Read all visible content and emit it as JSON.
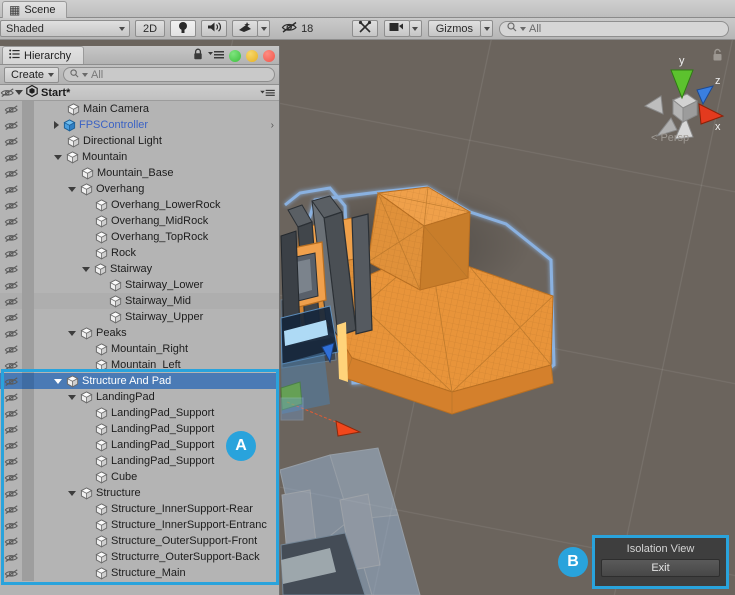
{
  "window": {
    "scene_tab_label": "Scene",
    "scene_tab_icon": "grid-hash-icon"
  },
  "toolbar": {
    "shading_mode": "Shaded",
    "mode_2d_label": "2D",
    "lighting_icon": "lightbulb-icon",
    "audio_icon": "speaker-icon",
    "effects_icon": "fx-icon",
    "hidden_count_icon": "eye-off-icon",
    "hidden_count": "18",
    "tools_icon": "tools-icon",
    "camera_icon": "camera-icon",
    "gizmos_label": "Gizmos",
    "search_placeholder": "All",
    "search_value": "",
    "search_icon": "search-icon"
  },
  "hierarchy": {
    "tab_label": "Hierarchy",
    "tab_icon": "list-icon",
    "lock_icon": "lock-icon",
    "menu_icon": "hamburger-menu-icon",
    "window_dots": [
      "green",
      "yellow",
      "red"
    ],
    "create_label": "Create",
    "search_placeholder": "All",
    "search_value": "",
    "scene_root": "Start*",
    "scene_root_icon": "unity-scene-icon",
    "items": [
      {
        "label": "Main Camera",
        "depth": 1,
        "arrow": "none",
        "selected": false,
        "alt": false,
        "blue": false
      },
      {
        "label": "FPSController",
        "depth": 1,
        "arrow": "closed",
        "selected": false,
        "alt": false,
        "blue": true,
        "prefab": true,
        "chevron": true
      },
      {
        "label": "Directional Light",
        "depth": 1,
        "arrow": "none",
        "selected": false,
        "alt": false,
        "blue": false
      },
      {
        "label": "Mountain",
        "depth": 1,
        "arrow": "open",
        "selected": false,
        "alt": false,
        "blue": false
      },
      {
        "label": "Mountain_Base",
        "depth": 2,
        "arrow": "none",
        "selected": false,
        "alt": false,
        "blue": false
      },
      {
        "label": "Overhang",
        "depth": 2,
        "arrow": "open",
        "selected": false,
        "alt": false,
        "blue": false
      },
      {
        "label": "Overhang_LowerRock",
        "depth": 3,
        "arrow": "none",
        "selected": false,
        "alt": false,
        "blue": false
      },
      {
        "label": "Overhang_MidRock",
        "depth": 3,
        "arrow": "none",
        "selected": false,
        "alt": false,
        "blue": false
      },
      {
        "label": "Overhang_TopRock",
        "depth": 3,
        "arrow": "none",
        "selected": false,
        "alt": false,
        "blue": false
      },
      {
        "label": "Rock",
        "depth": 3,
        "arrow": "none",
        "selected": false,
        "alt": false,
        "blue": false
      },
      {
        "label": "Stairway",
        "depth": 3,
        "arrow": "open",
        "selected": false,
        "alt": false,
        "blue": false
      },
      {
        "label": "Stairway_Lower",
        "depth": 4,
        "arrow": "none",
        "selected": false,
        "alt": false,
        "blue": false
      },
      {
        "label": "Stairway_Mid",
        "depth": 4,
        "arrow": "none",
        "selected": false,
        "alt": true,
        "blue": false
      },
      {
        "label": "Stairway_Upper",
        "depth": 4,
        "arrow": "none",
        "selected": false,
        "alt": false,
        "blue": false
      },
      {
        "label": "Peaks",
        "depth": 2,
        "arrow": "open",
        "selected": false,
        "alt": false,
        "blue": false
      },
      {
        "label": "Mountain_Right",
        "depth": 3,
        "arrow": "none",
        "selected": false,
        "alt": false,
        "blue": false
      },
      {
        "label": "Mountain_Left",
        "depth": 3,
        "arrow": "none",
        "selected": false,
        "alt": false,
        "blue": false
      },
      {
        "label": "Structure And Pad",
        "depth": 1,
        "arrow": "open",
        "selected": true,
        "alt": false,
        "blue": false
      },
      {
        "label": "LandingPad",
        "depth": 2,
        "arrow": "open",
        "selected": false,
        "alt": false,
        "blue": false
      },
      {
        "label": "LandingPad_Support",
        "depth": 3,
        "arrow": "none",
        "selected": false,
        "alt": false,
        "blue": false
      },
      {
        "label": "LandingPad_Support",
        "depth": 3,
        "arrow": "none",
        "selected": false,
        "alt": false,
        "blue": false
      },
      {
        "label": "LandingPad_Support",
        "depth": 3,
        "arrow": "none",
        "selected": false,
        "alt": false,
        "blue": false
      },
      {
        "label": "LandingPad_Support",
        "depth": 3,
        "arrow": "none",
        "selected": false,
        "alt": false,
        "blue": false
      },
      {
        "label": "Cube",
        "depth": 3,
        "arrow": "none",
        "selected": false,
        "alt": false,
        "blue": false
      },
      {
        "label": "Structure",
        "depth": 2,
        "arrow": "open",
        "selected": false,
        "alt": false,
        "blue": false
      },
      {
        "label": "Structure_InnerSupport-Rear",
        "depth": 3,
        "arrow": "none",
        "selected": false,
        "alt": false,
        "blue": false
      },
      {
        "label": "Structure_InnerSupport-Entranc",
        "depth": 3,
        "arrow": "none",
        "selected": false,
        "alt": false,
        "blue": false
      },
      {
        "label": "Structure_OuterSupport-Front",
        "depth": 3,
        "arrow": "none",
        "selected": false,
        "alt": false,
        "blue": false
      },
      {
        "label": "Structurre_OuterSupport-Back",
        "depth": 3,
        "arrow": "none",
        "selected": false,
        "alt": false,
        "blue": false
      },
      {
        "label": "Structure_Main",
        "depth": 3,
        "arrow": "none",
        "selected": false,
        "alt": false,
        "blue": false
      }
    ]
  },
  "scene_gizmo": {
    "axis_x": "x",
    "axis_y": "y",
    "axis_z": "z",
    "projection_label": "Persp",
    "projection_arrow_icon": "chevron-left-icon",
    "lock_icon": "lock-open-icon",
    "color_x": "#e33a1e",
    "color_y": "#5cc22e",
    "color_z": "#3a7fe0"
  },
  "isolation_panel": {
    "title": "Isolation View",
    "exit_label": "Exit"
  },
  "annotations": [
    {
      "badge": "A",
      "target": "hierarchy-structure-and-pad-subtree"
    },
    {
      "badge": "B",
      "target": "isolation-view-panel"
    }
  ],
  "colors": {
    "selection_blue": "#4a7ab5",
    "annotation_blue": "#29a3dc",
    "selected_mesh_orange": "#e8943a",
    "scene_background": "#6b645d"
  }
}
